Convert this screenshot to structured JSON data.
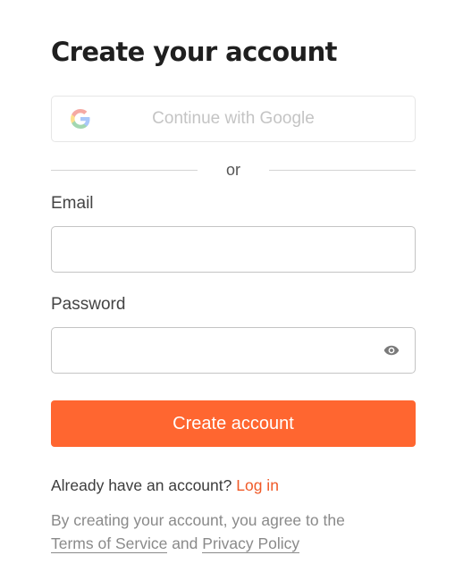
{
  "page": {
    "title": "Create your account"
  },
  "google": {
    "label": "Continue with Google",
    "icon": "google-icon"
  },
  "divider": {
    "text": "or"
  },
  "email": {
    "label": "Email",
    "value": "",
    "placeholder": ""
  },
  "password": {
    "label": "Password",
    "value": "",
    "placeholder": "",
    "toggle_icon": "eye-icon"
  },
  "submit": {
    "label": "Create account",
    "color": "#ff6630"
  },
  "login": {
    "prompt": "Already have an account?",
    "link": "Log in",
    "link_color": "#f05a28"
  },
  "terms": {
    "prefix": "By creating your account, you agree to the",
    "tos_link": "Terms of Service",
    "conjunction": "and",
    "privacy_link": "Privacy Policy"
  }
}
